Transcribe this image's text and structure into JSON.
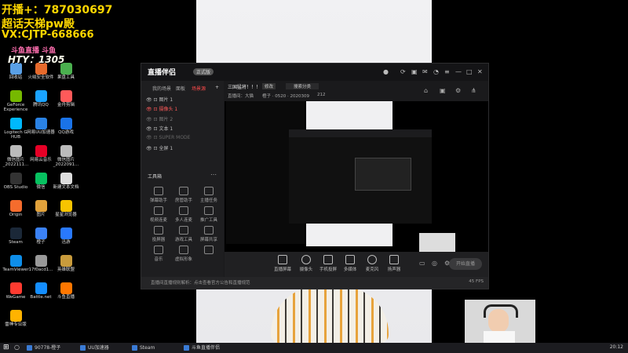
{
  "overlay": {
    "line1": "开播+：787030697",
    "line2": "超话天梯pw殿",
    "line3": "VX:CJTP-668666",
    "line4": "斗鱼直播 斗鱼",
    "line5": "HTY：1305"
  },
  "desktop_icons": [
    {
      "label": "回收站",
      "color": "#5aa0e6"
    },
    {
      "label": "火绒安全软件",
      "color": "#e66a2c"
    },
    {
      "label": "果盘工具",
      "color": "#4bb04f"
    },
    {
      "label": "GeForce Experience",
      "color": "#76b900"
    },
    {
      "label": "腾讯QQ",
      "color": "#1aa3ff"
    },
    {
      "label": "金舟剪辑",
      "color": "#ff5a5a"
    },
    {
      "label": "Logitech G HUB",
      "color": "#00b8fc"
    },
    {
      "label": "网易UU加速器",
      "color": "#2a82e4"
    },
    {
      "label": "QQ游戏",
      "color": "#1a73e8"
    },
    {
      "label": "微信图片_2022111...",
      "color": "#bbbbbb"
    },
    {
      "label": "网易云音乐",
      "color": "#e60026"
    },
    {
      "label": "微信图片_2022091...",
      "color": "#bbbbbb"
    },
    {
      "label": "OBS Studio",
      "color": "#333333"
    },
    {
      "label": "微信",
      "color": "#07c160"
    },
    {
      "label": "新建文本文档",
      "color": "#dddddd"
    },
    {
      "label": "Origin",
      "color": "#f56c2d"
    },
    {
      "label": "图片",
      "color": "#e2a23b"
    },
    {
      "label": "星星浏览器",
      "color": "#f7c400"
    },
    {
      "label": "Steam",
      "color": "#1b2838"
    },
    {
      "label": "橙子",
      "color": "#3b82f6"
    },
    {
      "label": "迅游",
      "color": "#2979ff"
    },
    {
      "label": "TeamViewer",
      "color": "#0e8ee9"
    },
    {
      "label": "17f0acd1...",
      "color": "#999999"
    },
    {
      "label": "英雄联盟",
      "color": "#c89b3c"
    },
    {
      "label": "WeGame",
      "color": "#ff3b30"
    },
    {
      "label": "Battle.net",
      "color": "#148eff"
    },
    {
      "label": "斗鱼直播",
      "color": "#ff7700"
    },
    {
      "label": "雷神专业版",
      "color": "#ffb300"
    }
  ],
  "app": {
    "logo": "直播伴侣",
    "version_badge": "正式版",
    "tabs": [
      "我的场景",
      "面板",
      "场景源"
    ],
    "sources": [
      "图片 1",
      "摄像头 1",
      "图片 2",
      "文本 1",
      "SUPER MODE",
      "全屏 1"
    ],
    "tools_title": "工具箱",
    "tools": [
      "弹幕助手",
      "房管助手",
      "主播任务",
      "视频连麦",
      "多人连麦",
      "推广工具",
      "投屏器",
      "游戏工具",
      "屏幕共享",
      "音乐",
      "虚拟形象",
      ""
    ],
    "toprow": {
      "stream_title": "三国猛将！！！",
      "category": "搜索分类",
      "action1": "修改",
      "room_info": "直播间：大猫",
      "online": "在线",
      "stats": "橙子 · 0520 · 2020309",
      "fans": "212"
    },
    "bottom_buttons": [
      "直播屏幕",
      "摄像头",
      "手机投屏",
      "多媒体",
      "麦克风",
      "扬声器"
    ],
    "golive_label": "开始直播",
    "notice": "直播间直播规则解析：点击查看官方公告和直播规范",
    "notice_right": "45 FPS"
  },
  "taskbar": {
    "items": [
      "90778-橙子",
      "UU加速器",
      "Steam",
      "斗鱼直播伴侣"
    ],
    "clock": "20:12"
  }
}
